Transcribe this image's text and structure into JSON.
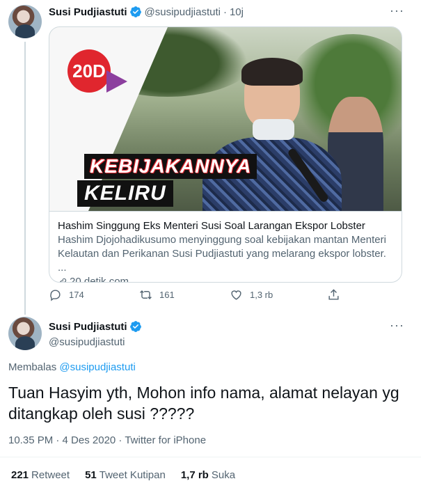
{
  "tweet1": {
    "name": "Susi Pudjiastuti",
    "handle": "@susipudjiastuti",
    "dot": "·",
    "time": "10j",
    "more": "···",
    "card": {
      "logo_text": "20D",
      "headline_line1": "KEBIJAKANNYA",
      "headline_line2": "KELIRU",
      "title": "Hashim Singgung Eks Menteri Susi Soal Larangan Ekspor Lobster",
      "description": "Hashim Djojohadikusumo menyinggung soal kebijakan mantan Menteri Kelautan dan Perikanan Susi Pudjiastuti yang melarang ekspor lobster. ...",
      "domain": "20.detik.com"
    },
    "actions": {
      "reply_count": "174",
      "retweet_count": "161",
      "like_count": "1,3 rb"
    }
  },
  "tweet2": {
    "name": "Susi Pudjiastuti",
    "handle": "@susipudjiastuti",
    "more": "···",
    "reply_prefix": "Membalas",
    "reply_mention": "@susipudjiastuti",
    "text": "Tuan Hasyim yth, Mohon info nama, alamat nelayan yg ditangkap oleh susi ?????",
    "meta": "10.35 PM · 4 Des 2020 · Twitter for iPhone",
    "stats": {
      "retweets_count": "221",
      "retweets_label": "Retweet",
      "quotes_count": "51",
      "quotes_label": "Tweet Kutipan",
      "likes_count": "1,7 rb",
      "likes_label": "Suka"
    }
  },
  "colors": {
    "accent": "#1d9bf0",
    "secondary_text": "#536471",
    "border": "#cfd9de",
    "logo_red": "#e0262e"
  },
  "icons": [
    "verified-badge-icon",
    "more-icon",
    "link-icon",
    "reply-icon",
    "retweet-icon",
    "like-icon",
    "share-icon"
  ]
}
